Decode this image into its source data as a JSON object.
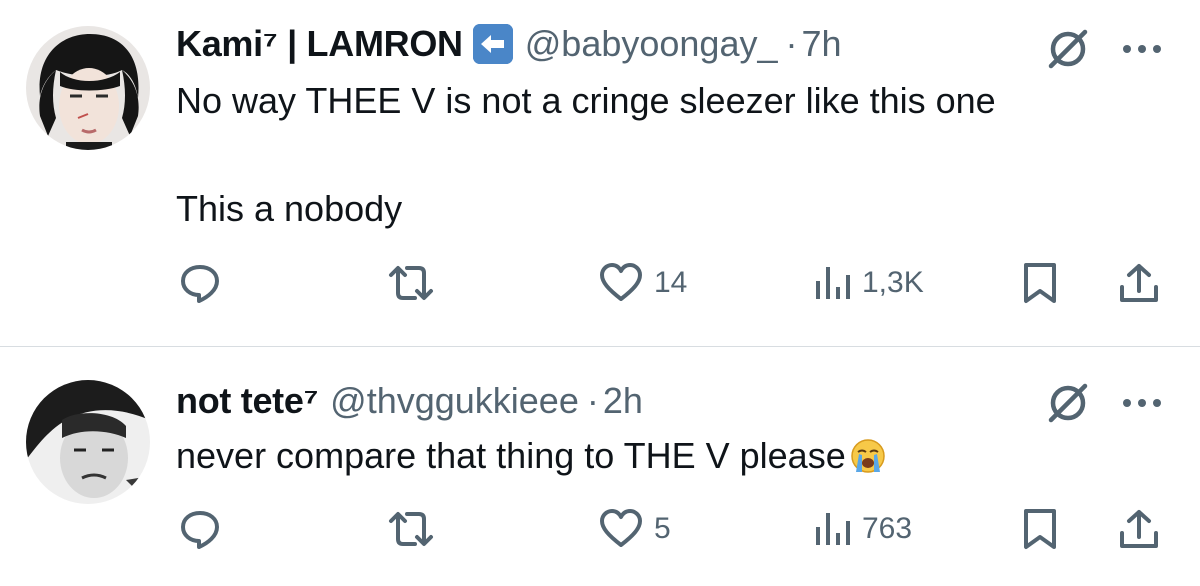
{
  "tweets": [
    {
      "display_name": "Kami⁷ | LAMRON",
      "badge_icon": "left-arrow-emoji-icon",
      "handle": "@babyoongay_",
      "separator": "·",
      "time": "7h",
      "text_lines": [
        "No way THEE V is not a cringe sleezer like this one",
        "This a nobody"
      ],
      "reply_count": "",
      "retweet_count": "",
      "like_count": "14",
      "view_count": "1,3K"
    },
    {
      "display_name": "not tete⁷",
      "handle": "@thvggukkieee",
      "separator": "·",
      "time": "2h",
      "text_lines": [
        "never compare that thing to THE V please"
      ],
      "emoji": "loudly-crying-face-icon",
      "reply_count": "",
      "retweet_count": "",
      "like_count": "5",
      "view_count": "763"
    }
  ],
  "colors": {
    "text": "#0f1419",
    "secondary": "#536471",
    "divider": "#d8dde1",
    "badge": "#4a86c8"
  }
}
